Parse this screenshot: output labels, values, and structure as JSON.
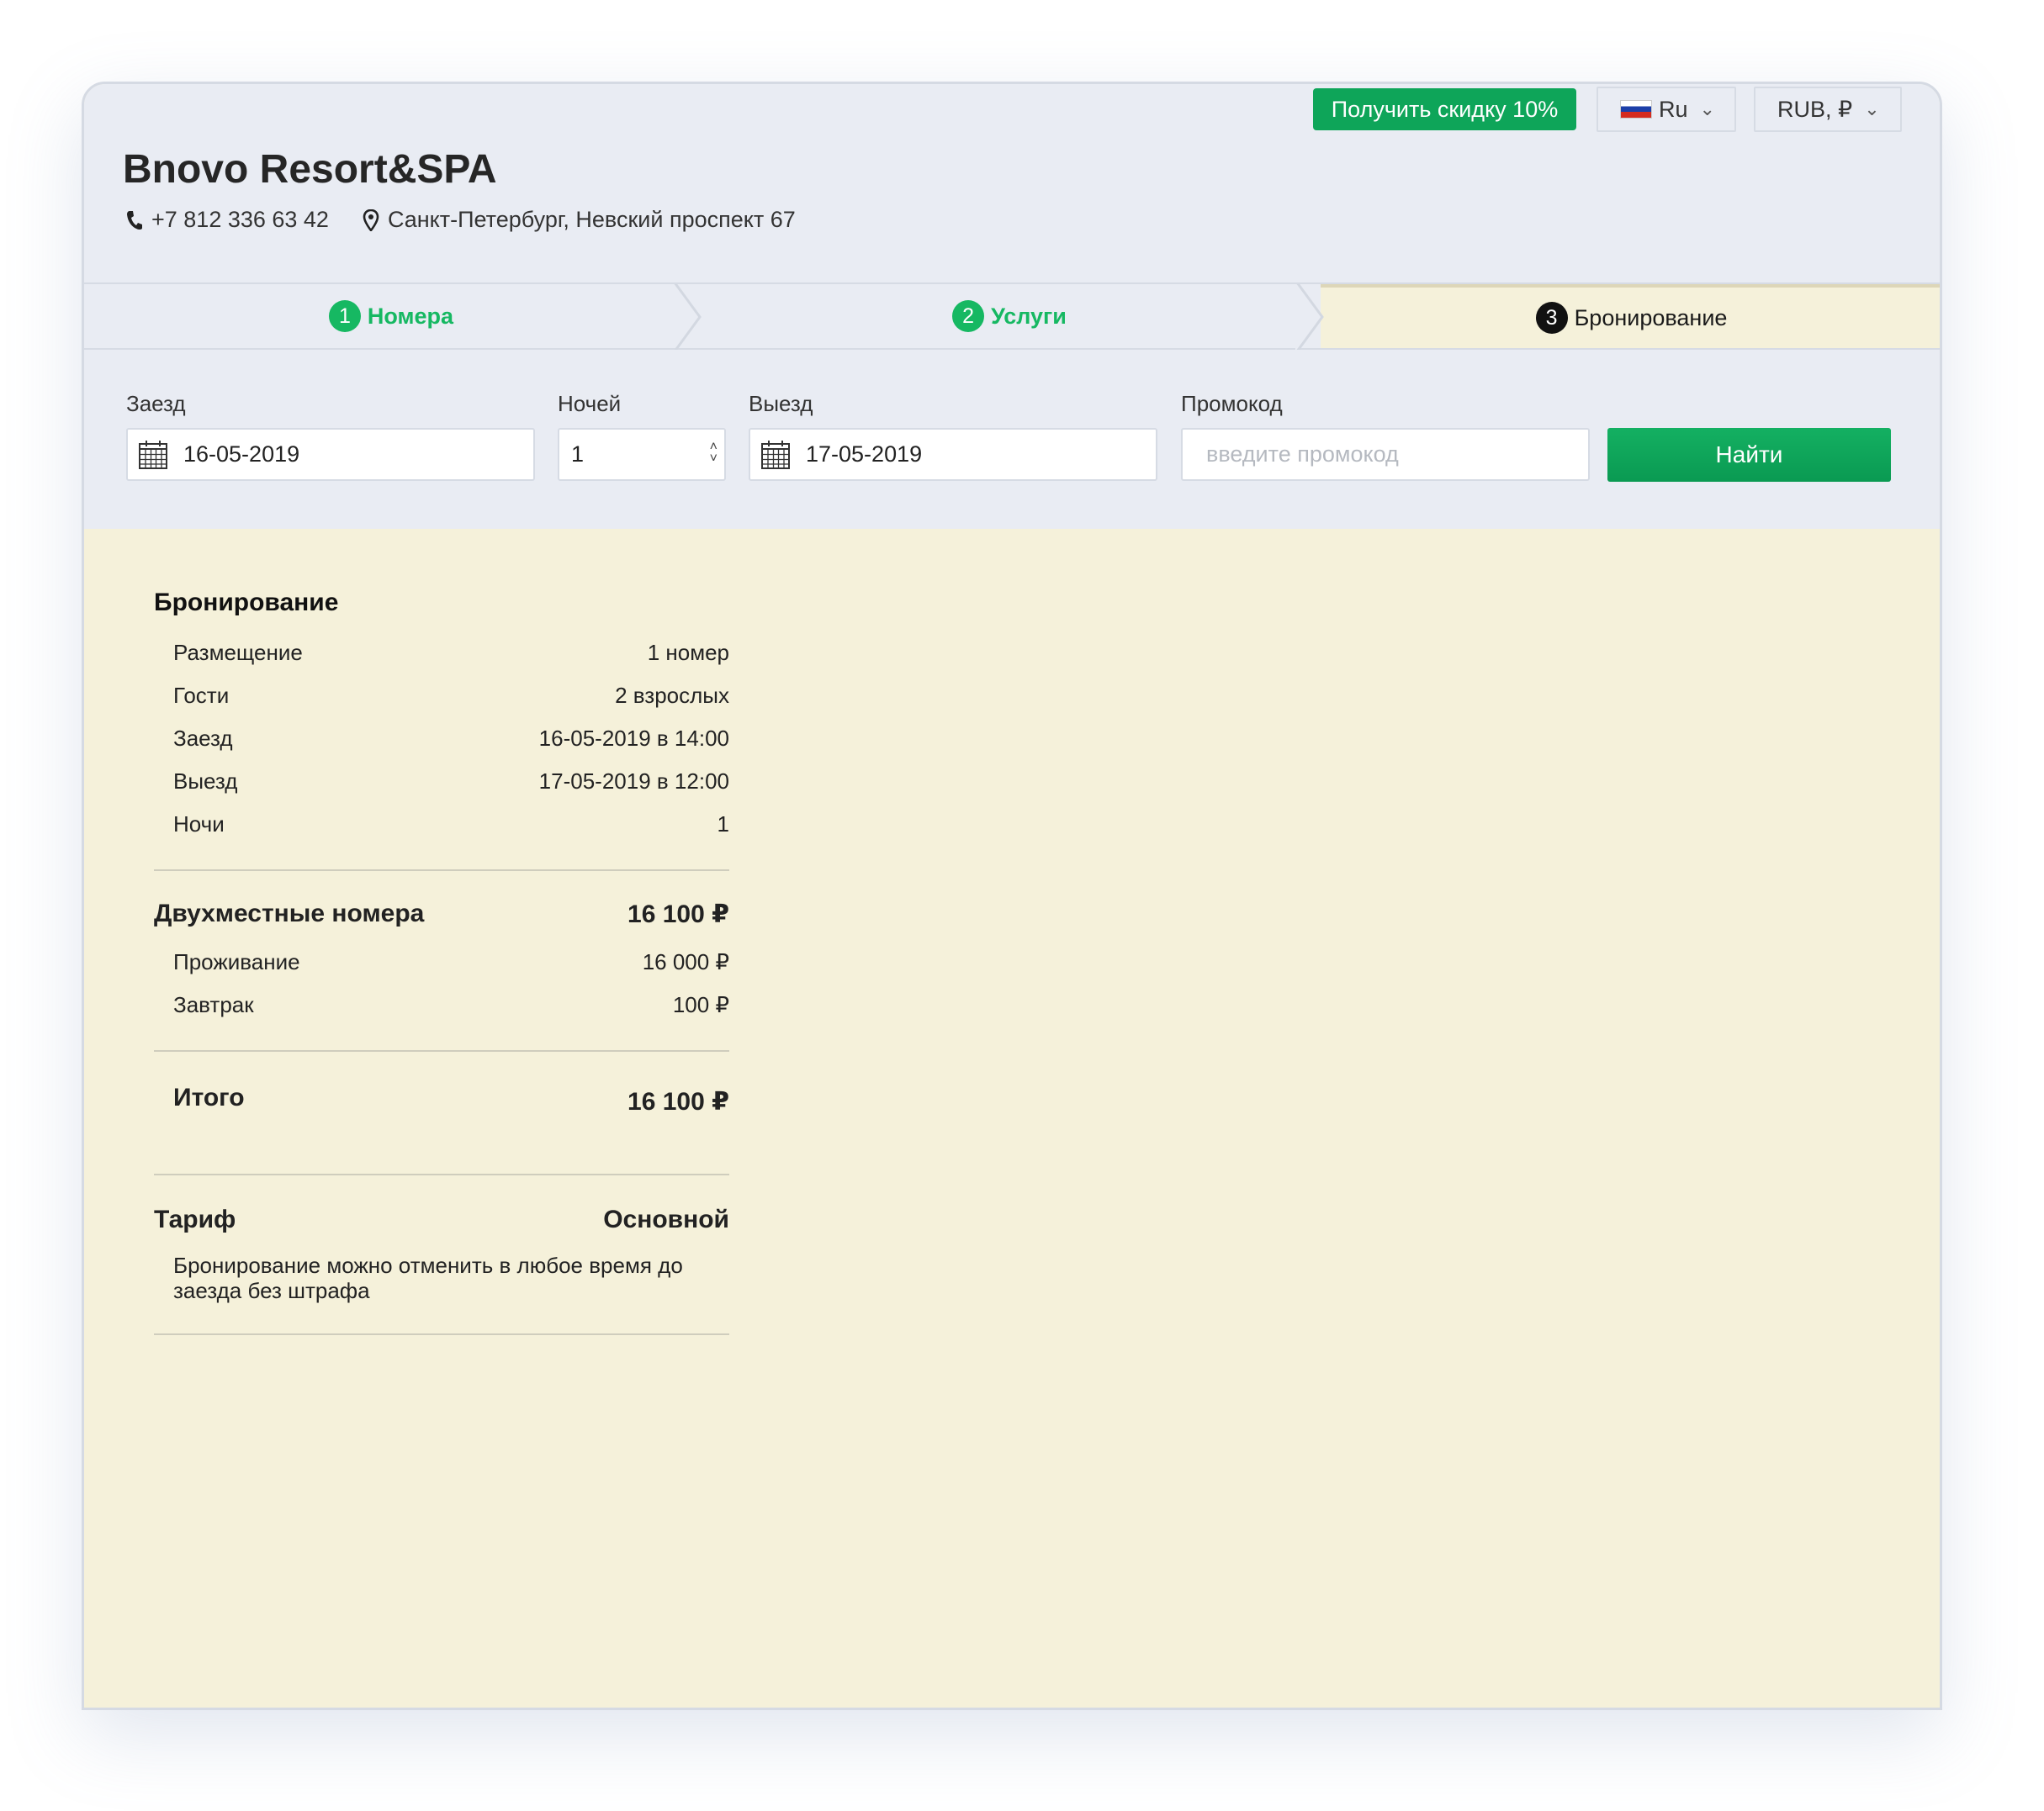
{
  "header": {
    "discount_button": "Получить скидку 10%",
    "language": "Ru",
    "currency": "RUB, ₽",
    "hotel_name": "Bnovo Resort&SPA",
    "phone": "+7 812 336 63 42",
    "address": "Санкт-Петербург, Невский проспект 67"
  },
  "steps": [
    {
      "num": "1",
      "label": "Номера",
      "state": "done"
    },
    {
      "num": "2",
      "label": "Услуги",
      "state": "done"
    },
    {
      "num": "3",
      "label": "Бронирование",
      "state": "active"
    }
  ],
  "search": {
    "checkin_label": "Заезд",
    "checkin_value": "16-05-2019",
    "nights_label": "Ночей",
    "nights_value": "1",
    "checkout_label": "Выезд",
    "checkout_value": "17-05-2019",
    "promo_label": "Промокод",
    "promo_placeholder": "введите промокод",
    "find_button": "Найти"
  },
  "booking": {
    "title": "Бронирование",
    "rows": [
      {
        "label": "Размещение",
        "value": "1 номер"
      },
      {
        "label": "Гости",
        "value": "2 взрослых"
      },
      {
        "label": "Заезд",
        "value": "16-05-2019 в 14:00"
      },
      {
        "label": "Выезд",
        "value": "17-05-2019 в 12:00"
      },
      {
        "label": "Ночи",
        "value": "1"
      }
    ],
    "room_title": "Двухместные номера",
    "room_total": "16 100 ₽",
    "room_rows": [
      {
        "label": "Проживание",
        "value": "16 000 ₽"
      },
      {
        "label": "Завтрак",
        "value": "100 ₽"
      }
    ],
    "total_label": "Итого",
    "total_value": "16 100 ₽",
    "tariff_label": "Тариф",
    "tariff_value": "Основной",
    "tariff_note": "Бронирование можно отменить в любое время до заезда без штрафа"
  },
  "colors": {
    "accent_green": "#0ea559",
    "step_green": "#16b862",
    "header_bg": "#e9ecf3",
    "content_bg": "#f5f1da"
  }
}
